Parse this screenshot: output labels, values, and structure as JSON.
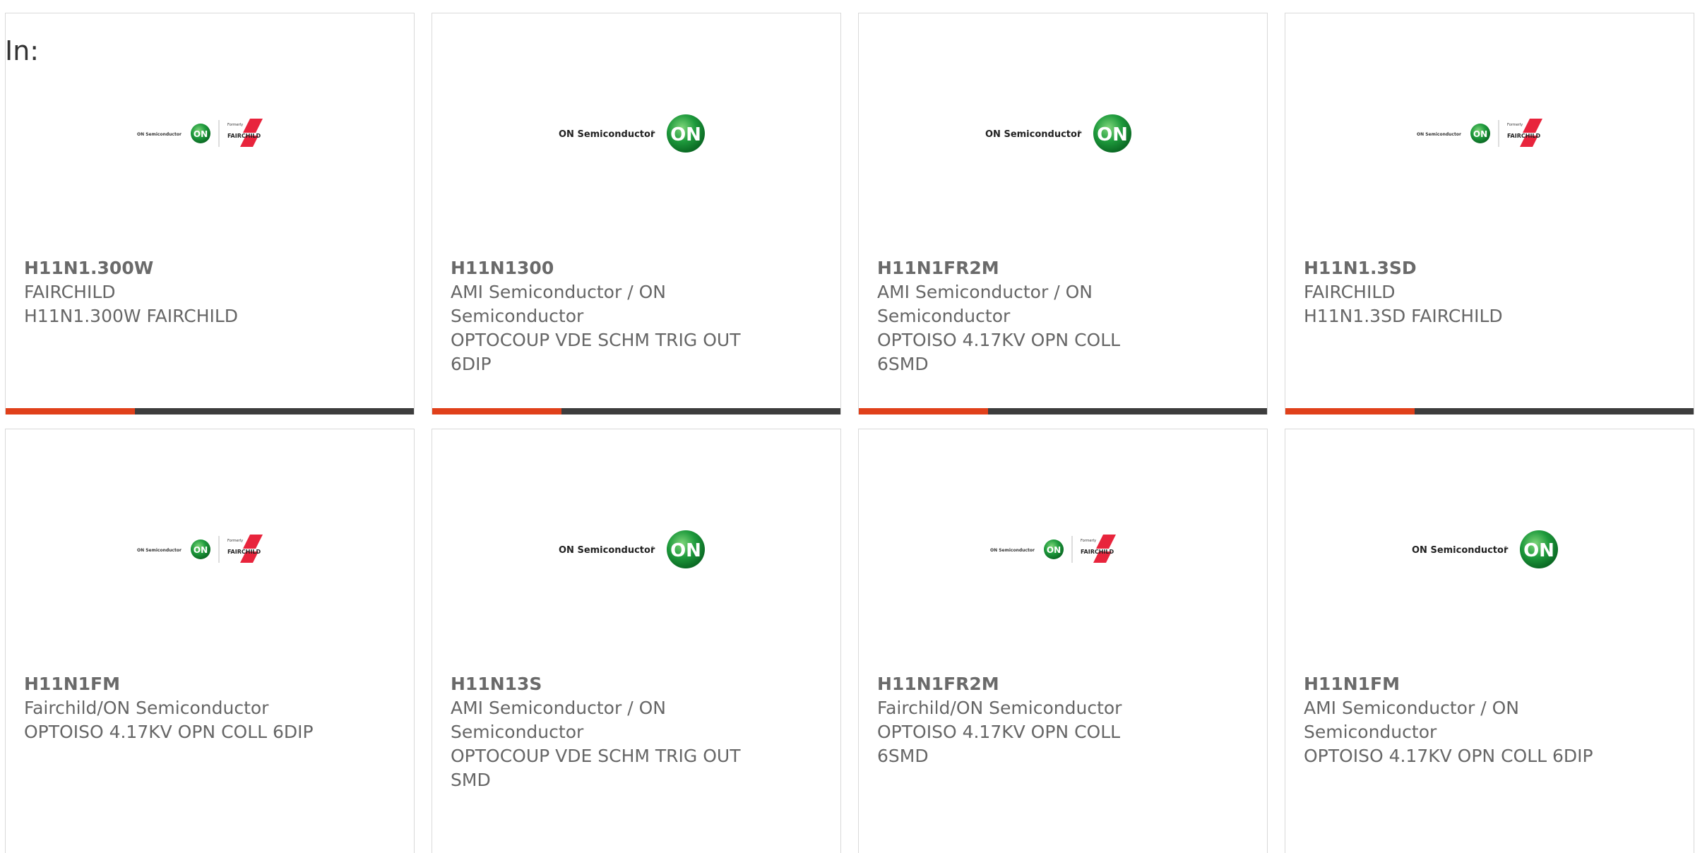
{
  "filter_label": "In:",
  "colors": {
    "accent": "#e0401a",
    "bar": "#3d3d3d",
    "on_green": "#1e9a3c",
    "fairchild_red": "#e8243c"
  },
  "logo_text": {
    "on_semi": "ON Semiconductor",
    "on": "ON",
    "formerly": "Formerly",
    "fairchild": "FAIRCHILD"
  },
  "cards": [
    {
      "part_number": "H11N1.300W",
      "lines": [
        "FAIRCHILD",
        "H11N1.300W FAIRCHILD"
      ],
      "logo": "on-fairchild-logo"
    },
    {
      "part_number": "H11N1300",
      "lines": [
        "AMI Semiconductor / ON",
        "Semiconductor",
        "OPTOCOUP VDE SCHM TRIG OUT",
        "6DIP"
      ],
      "logo": "on-semi-logo"
    },
    {
      "part_number": "H11N1FR2M",
      "lines": [
        "AMI Semiconductor / ON",
        "Semiconductor",
        "OPTOISO 4.17KV OPN COLL",
        "6SMD"
      ],
      "logo": "on-semi-logo"
    },
    {
      "part_number": "H11N1.3SD",
      "lines": [
        "FAIRCHILD",
        "H11N1.3SD FAIRCHILD"
      ],
      "logo": "on-fairchild-logo"
    },
    {
      "part_number": "H11N1FM",
      "lines": [
        "Fairchild/ON Semiconductor",
        "OPTOISO 4.17KV OPN COLL 6DIP"
      ],
      "logo": "on-fairchild-logo"
    },
    {
      "part_number": "H11N13S",
      "lines": [
        "AMI Semiconductor / ON",
        "Semiconductor",
        "OPTOCOUP VDE SCHM TRIG OUT",
        "SMD"
      ],
      "logo": "on-semi-logo"
    },
    {
      "part_number": "H11N1FR2M",
      "lines": [
        "Fairchild/ON Semiconductor",
        "OPTOISO 4.17KV OPN COLL",
        "6SMD"
      ],
      "logo": "on-fairchild-logo"
    },
    {
      "part_number": "H11N1FM",
      "lines": [
        "AMI Semiconductor / ON",
        "Semiconductor",
        "OPTOISO 4.17KV OPN COLL 6DIP"
      ],
      "logo": "on-semi-logo"
    }
  ]
}
